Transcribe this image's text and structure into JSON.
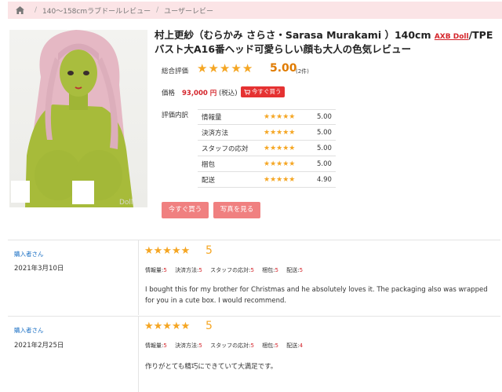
{
  "breadcrumb": {
    "home_icon": "home-icon",
    "items": [
      "140～158cmラブドールレビュー",
      "ユーザーレビー"
    ]
  },
  "product": {
    "title_main": "村上更紗（むらかみ さらさ・Sarasa Murakami ）140cm ",
    "brand": "AXB Doll",
    "title_rest": "/TPEバスト大A16番ヘッド可愛らしい顔も大人の色気レビュー",
    "watermark": "Doll",
    "overall_label": "総合評価",
    "overall_score": "5.00",
    "overall_count": "(2件)",
    "overall_stars": 5,
    "price_label": "価格",
    "price_value": "93,000 円",
    "price_tax": "(税込)",
    "buy_small_label": "今すぐ買う",
    "breakdown_label": "評価内訳",
    "breakdown": [
      {
        "label": "情報量",
        "value": "5.00",
        "stars": 5
      },
      {
        "label": "決済方法",
        "value": "5.00",
        "stars": 5
      },
      {
        "label": "スタッフの応対",
        "value": "5.00",
        "stars": 5
      },
      {
        "label": "梱包",
        "value": "5.00",
        "stars": 5
      },
      {
        "label": "配送",
        "value": "4.90",
        "stars": 5
      }
    ],
    "buy_button": "今すぐ買う",
    "photos_button": "写真を見る"
  },
  "reviews": [
    {
      "reviewer": "購入者さん",
      "date": "2021年3月10日",
      "score": "5",
      "stars": 5,
      "details": [
        {
          "label": "情報量:",
          "value": "5"
        },
        {
          "label": "決済方法:",
          "value": "5"
        },
        {
          "label": "スタッフの応対:",
          "value": "5"
        },
        {
          "label": "梱包:",
          "value": "5"
        },
        {
          "label": "配送:",
          "value": "5"
        }
      ],
      "body": "I bought this for my brother for Christmas and he absolutely loves it. The packaging also was wrapped for you in a cute box. I would recommend."
    },
    {
      "reviewer": "購入者さん",
      "date": "2021年2月25日",
      "score": "5",
      "stars": 5,
      "details": [
        {
          "label": "情報量:",
          "value": "5"
        },
        {
          "label": "決済方法:",
          "value": "5"
        },
        {
          "label": "スタッフの応対:",
          "value": "5"
        },
        {
          "label": "梱包:",
          "value": "5"
        },
        {
          "label": "配送:",
          "value": "4"
        }
      ],
      "body": "作りがとても精巧にできていて大満足です。"
    }
  ],
  "colors": {
    "accent_red": "#d4242a",
    "star": "#f5a623",
    "button_pink": "#f08080",
    "breadcrumb_bg": "#fbe4e6"
  }
}
